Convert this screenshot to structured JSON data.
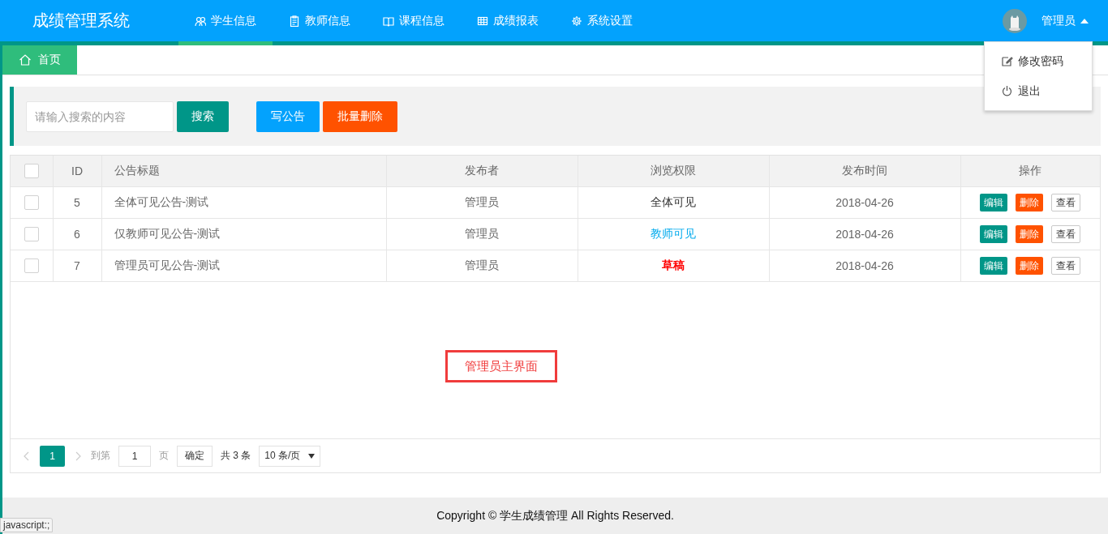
{
  "header": {
    "logo": "成绩管理系统",
    "nav": [
      {
        "label": "学生信息",
        "kind": "users",
        "selected": true
      },
      {
        "label": "教师信息",
        "kind": "clipboard",
        "selected": false
      },
      {
        "label": "课程信息",
        "kind": "book",
        "selected": false
      },
      {
        "label": "成绩报表",
        "kind": "grid",
        "selected": false
      },
      {
        "label": "系统设置",
        "kind": "gear",
        "selected": false
      }
    ],
    "user": {
      "name": "管理员",
      "menu_expanded": true,
      "menu": [
        {
          "label": "修改密码",
          "kind": "edit"
        },
        {
          "label": "退出",
          "kind": "power"
        }
      ]
    }
  },
  "tabs": [
    {
      "label": "首页",
      "selected": true
    }
  ],
  "toolbar": {
    "search": {
      "placeholder": "请输入搜索的内容"
    },
    "buttons": [
      {
        "label": "搜索",
        "kind": "search"
      },
      {
        "label": "写公告",
        "kind": "create"
      },
      {
        "label": "批量删除",
        "kind": "danger"
      }
    ]
  },
  "table": {
    "select_all_checked": false,
    "columns": [
      "ID",
      "公告标题",
      "发布者",
      "浏览权限",
      "发布时间",
      "操作"
    ],
    "rows": [
      {
        "checked": false,
        "id": "5",
        "title": "全体可见公告-测试",
        "publisher": "管理员",
        "visibility": {
          "text": "全体可见",
          "color": "#333333"
        },
        "date": "2018-04-26",
        "actions": [
          {
            "label": "编辑",
            "kind": "edit"
          },
          {
            "label": "删除",
            "kind": "delete"
          },
          {
            "label": "查看",
            "kind": "view"
          }
        ]
      },
      {
        "checked": false,
        "id": "6",
        "title": "仅教师可见公告-测试",
        "publisher": "管理员",
        "visibility": {
          "text": "教师可见",
          "color": "#01aaed"
        },
        "date": "2018-04-26",
        "actions": [
          {
            "label": "编辑",
            "kind": "edit"
          },
          {
            "label": "删除",
            "kind": "delete"
          },
          {
            "label": "查看",
            "kind": "view"
          }
        ]
      },
      {
        "checked": false,
        "id": "7",
        "title": "管理员可见公告-测试",
        "publisher": "管理员",
        "visibility": {
          "text": "草稿",
          "color": "#ff0000"
        },
        "date": "2018-04-26",
        "actions": [
          {
            "label": "编辑",
            "kind": "edit"
          },
          {
            "label": "删除",
            "kind": "delete"
          },
          {
            "label": "查看",
            "kind": "view"
          }
        ]
      }
    ]
  },
  "annotation": "管理员主界面",
  "pagination": {
    "pages": [
      {
        "label": "1",
        "selected": true
      }
    ],
    "goto_label": "到第",
    "goto_value": "1",
    "page_unit": "页",
    "confirm": "确定",
    "total": "共 3 条",
    "page_size": "10 条/页"
  },
  "footer": "Copyright © 学生成绩管理 All Rights Reserved.",
  "status_link": "javascript:;"
}
